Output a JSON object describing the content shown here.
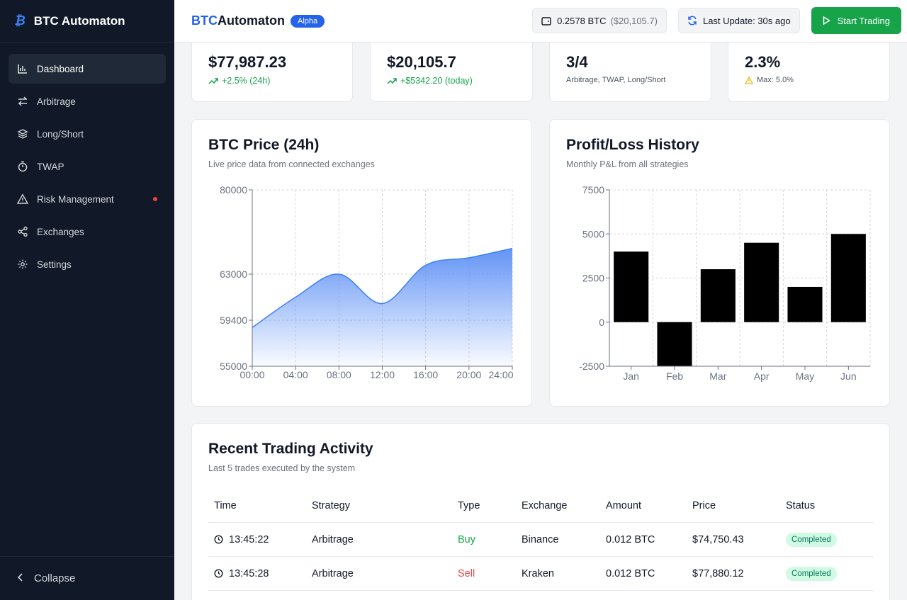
{
  "sidebar": {
    "brand": "BTC Automaton",
    "logo_glyph": "₿",
    "items": [
      {
        "label": "Dashboard",
        "icon": "bar-chart-icon",
        "active": true
      },
      {
        "label": "Arbitrage",
        "icon": "swap-arrows-icon"
      },
      {
        "label": "Long/Short",
        "icon": "layers-icon"
      },
      {
        "label": "TWAP",
        "icon": "timer-icon"
      },
      {
        "label": "Risk Management",
        "icon": "warning-triangle-icon",
        "alert": true
      },
      {
        "label": "Exchanges",
        "icon": "share-nodes-icon"
      },
      {
        "label": "Settings",
        "icon": "gear-icon"
      }
    ],
    "collapse_label": "Collapse"
  },
  "header": {
    "title_accent": "BTC",
    "title_rest": "Automaton",
    "badge": "Alpha",
    "wallet_btc": "0.2578 BTC",
    "wallet_usd": "($20,105.7)",
    "last_update": "Last Update: 30s ago",
    "start_button": "Start Trading"
  },
  "stats": [
    {
      "value": "$77,987.23",
      "sub": "+2.5% (24h)"
    },
    {
      "value": "$20,105.7",
      "sub": "+$5342.20 (today)"
    },
    {
      "value": "3/4",
      "sub": "Arbitrage, TWAP, Long/Short"
    },
    {
      "value": "2.3%",
      "sub": "Max: 5.0%"
    }
  ],
  "colors": {
    "accent": "#2563eb",
    "positive": "#16a34a",
    "negative": "#ef4444",
    "sidebar_bg": "#111827",
    "area_fill": "#5b8ef5"
  },
  "btc_chart": {
    "title": "BTC Price (24h)",
    "subtitle": "Live price data from connected exchanges"
  },
  "pnl_chart": {
    "title": "Profit/Loss History",
    "subtitle": "Monthly P&L from all strategies"
  },
  "chart_data": [
    {
      "type": "area",
      "title": "BTC Price (24h)",
      "x": [
        "00:00",
        "04:00",
        "08:00",
        "12:00",
        "16:00",
        "20:00",
        "24:00"
      ],
      "y": [
        58700,
        61200,
        63000,
        60700,
        64800,
        66300,
        68200
      ],
      "y_ticks": [
        55000,
        59400,
        63000,
        80000
      ],
      "ylim": [
        55000,
        80000
      ],
      "grid": true
    },
    {
      "type": "bar",
      "title": "Profit/Loss History",
      "categories": [
        "Jan",
        "Feb",
        "Mar",
        "Apr",
        "May",
        "Jun"
      ],
      "values": [
        4000,
        -3000,
        3000,
        4500,
        2000,
        5000
      ],
      "y_ticks": [
        -2500,
        0,
        2500,
        5000,
        7500
      ],
      "ylim": [
        -2500,
        7500
      ],
      "grid": true
    }
  ],
  "activity": {
    "title": "Recent Trading Activity",
    "subtitle": "Last 5 trades executed by the system",
    "columns": [
      "Time",
      "Strategy",
      "Type",
      "Exchange",
      "Amount",
      "Price",
      "Status"
    ],
    "rows": [
      {
        "time": "13:45:22",
        "strategy": "Arbitrage",
        "type": "Buy",
        "exchange": "Binance",
        "amount": "0.012 BTC",
        "price": "$74,750.43",
        "status": "Completed"
      },
      {
        "time": "13:45:28",
        "strategy": "Arbitrage",
        "type": "Sell",
        "exchange": "Kraken",
        "amount": "0.012 BTC",
        "price": "$77,880.12",
        "status": "Completed"
      }
    ]
  }
}
